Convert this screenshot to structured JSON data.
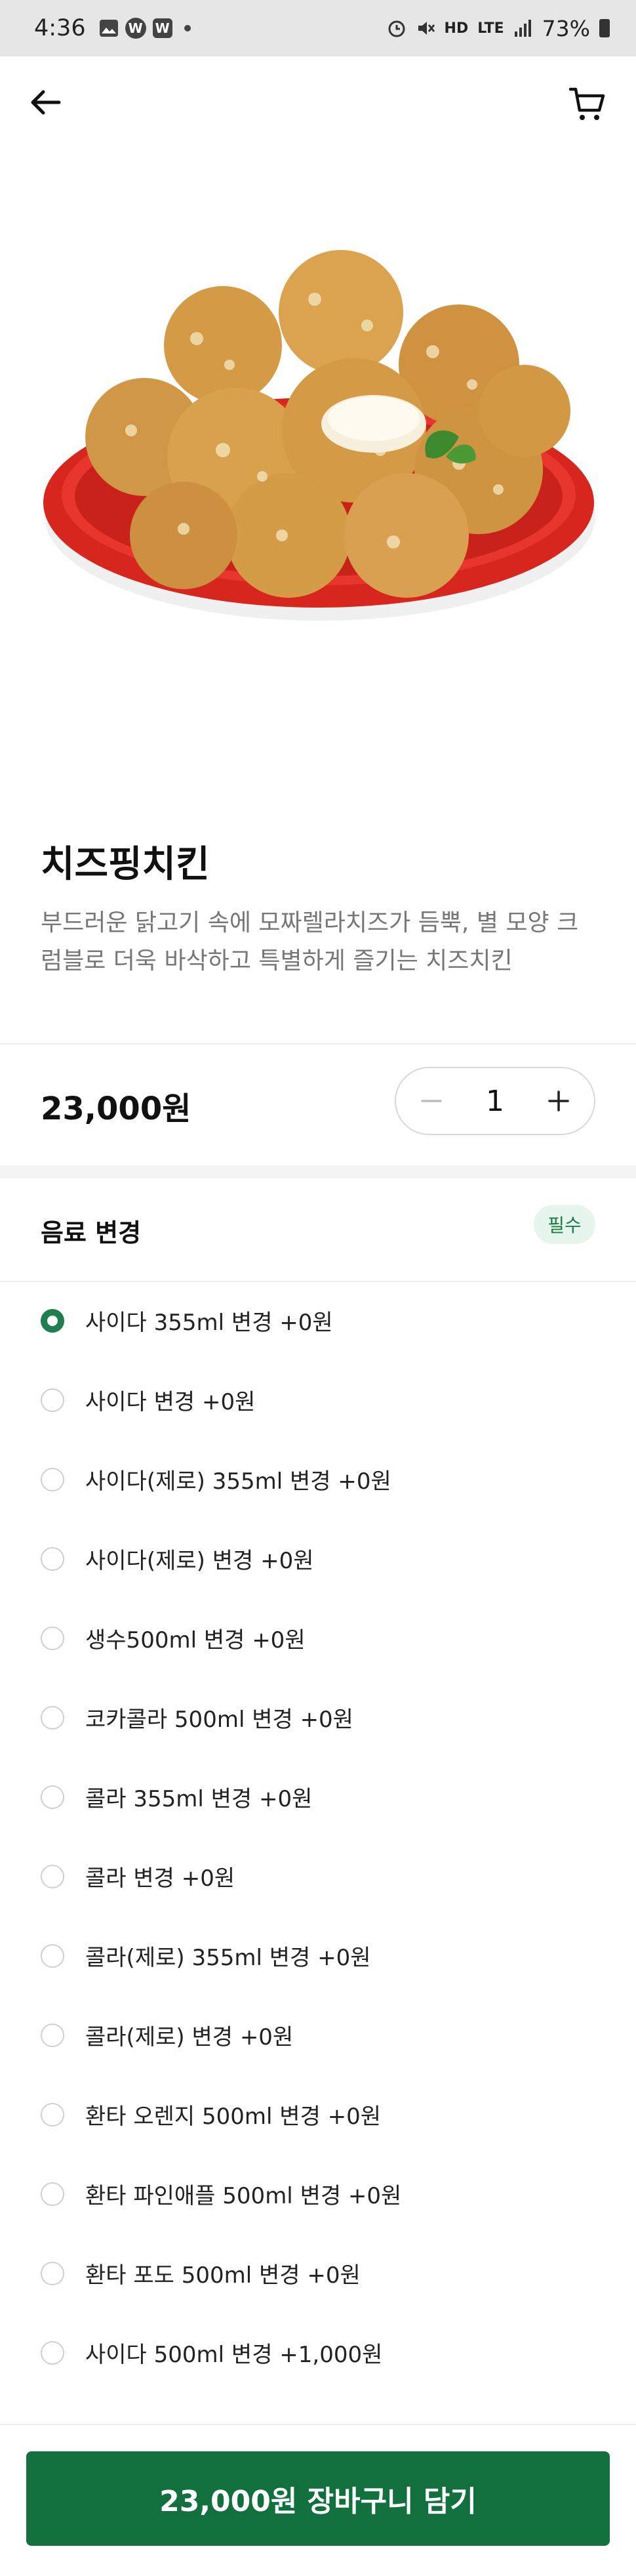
{
  "status_bar": {
    "time": "4:36",
    "left_icons": [
      "image-icon",
      "w-app-icon",
      "calendar-icon",
      "dot-icon"
    ],
    "right_icons": [
      "alarm-icon",
      "mute-icon",
      "hd-voice-icon",
      "lte-icon",
      "signal-icon"
    ],
    "hd_text": "HD",
    "lte_text": "LTE",
    "battery": "73%"
  },
  "nav": {
    "back_icon": "arrow-left-icon",
    "cart_icon": "cart-icon"
  },
  "product": {
    "image": "cheese-chicken-plate",
    "name": "치즈핑치킨",
    "description": "부드러운 닭고기 속에 모짜렐라치즈가 듬뿍, 별 모양 크럼블로 더욱 바삭하고 특별하게 즐기는 치즈치킨",
    "price": "23,000원",
    "quantity": "1"
  },
  "options": {
    "title": "음료 변경",
    "badge": "필수",
    "items": [
      {
        "label": "사이다 355ml 변경 +0원",
        "selected": true
      },
      {
        "label": "사이다 변경 +0원",
        "selected": false
      },
      {
        "label": "사이다(제로) 355ml 변경 +0원",
        "selected": false
      },
      {
        "label": "사이다(제로) 변경 +0원",
        "selected": false
      },
      {
        "label": "생수500ml 변경 +0원",
        "selected": false
      },
      {
        "label": "코카콜라 500ml 변경 +0원",
        "selected": false
      },
      {
        "label": "콜라 355ml 변경 +0원",
        "selected": false
      },
      {
        "label": "콜라 변경 +0원",
        "selected": false
      },
      {
        "label": "콜라(제로) 355ml 변경 +0원",
        "selected": false
      },
      {
        "label": "콜라(제로) 변경 +0원",
        "selected": false
      },
      {
        "label": "환타 오렌지 500ml 변경 +0원",
        "selected": false
      },
      {
        "label": "환타 파인애플 500ml 변경 +0원",
        "selected": false
      },
      {
        "label": "환타 포도 500ml 변경 +0원",
        "selected": false
      },
      {
        "label": "사이다 500ml 변경 +1,000원",
        "selected": false
      }
    ]
  },
  "cta": {
    "label": "23,000원 장바구니 담기"
  },
  "colors": {
    "brand_green": "#12703f",
    "radio_green": "#1f7d52",
    "badge_bg": "#e6f6ec"
  }
}
